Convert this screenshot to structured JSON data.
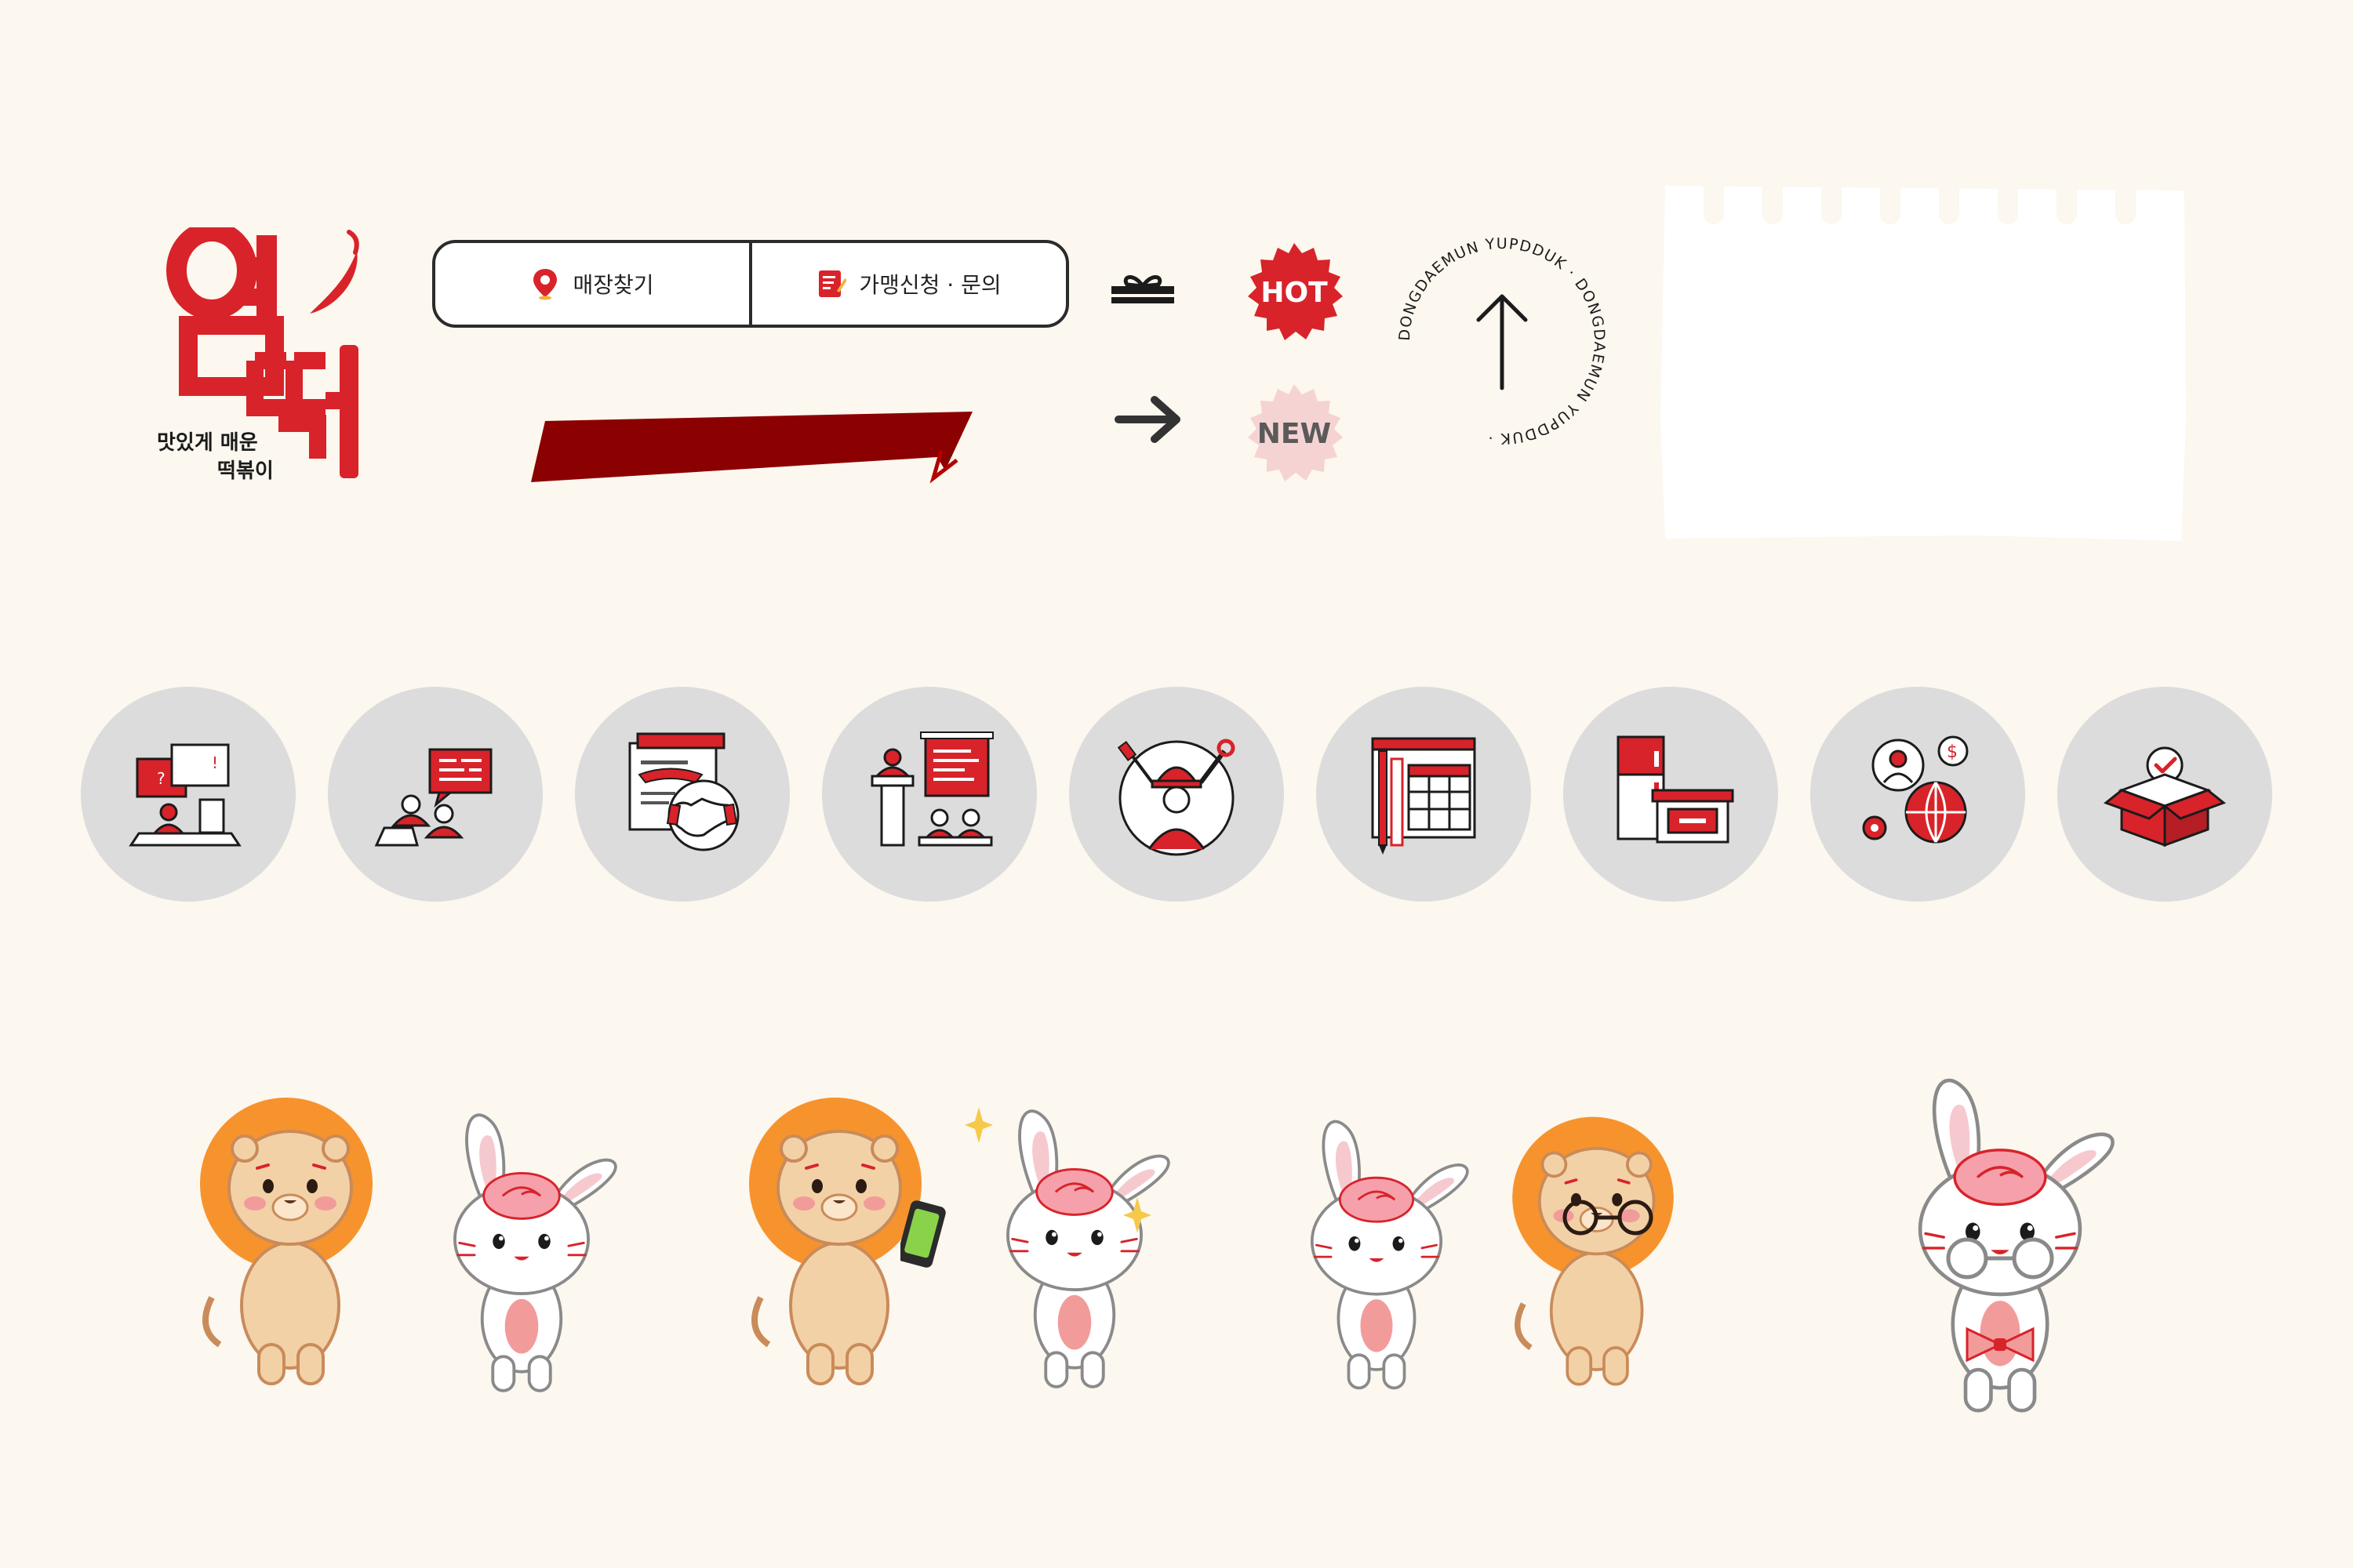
{
  "logo": {
    "tagline_line1": "맛있게 매운",
    "tagline_line2": "떡볶이"
  },
  "nav": {
    "store_finder_label": "매장찾기",
    "franchise_label": "가맹신청 · 문의"
  },
  "badges": {
    "hot": "HOT",
    "new": "NEW"
  },
  "circle_badge": {
    "ring_text": "DONGDAEMUN YUPDDUK · DONGDAEMUN YUPDDUK · "
  },
  "icons": [
    {
      "name": "consultation-icon"
    },
    {
      "name": "meeting-icon"
    },
    {
      "name": "contract-handshake-icon"
    },
    {
      "name": "presentation-seminar-icon"
    },
    {
      "name": "construction-worker-icon"
    },
    {
      "name": "planning-design-icon"
    },
    {
      "name": "kitchen-equipment-icon"
    },
    {
      "name": "global-business-icon"
    },
    {
      "name": "open-box-check-icon"
    }
  ],
  "colors": {
    "background": "#fcf7ef",
    "brand_red": "#d8232a",
    "dark_red": "#8b0000",
    "icon_circle": "#dcdcdc",
    "new_pink": "#f6d3d3",
    "lion_orange": "#f7932d"
  }
}
